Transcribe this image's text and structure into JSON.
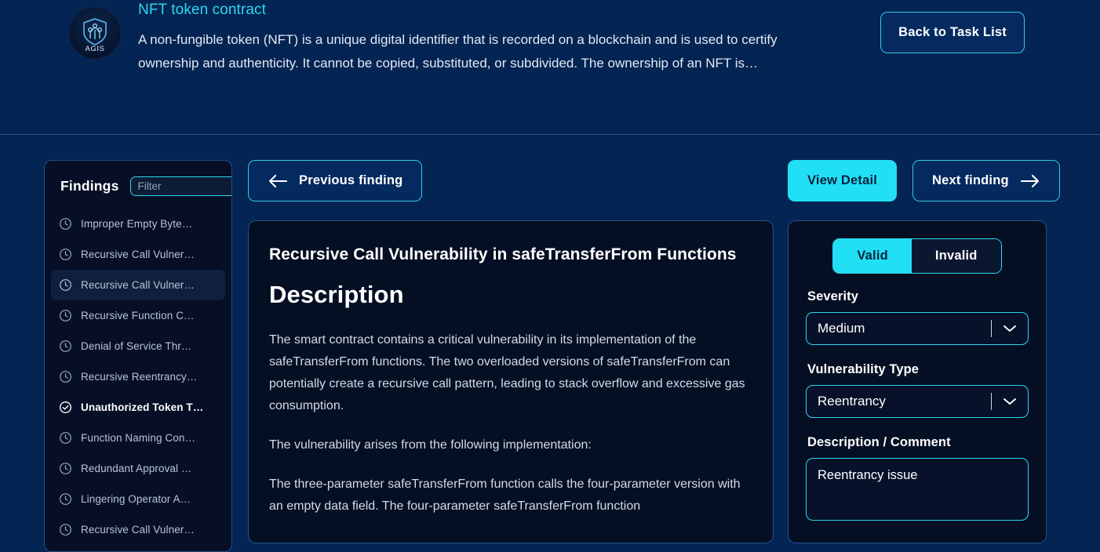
{
  "header": {
    "logo_text": "AGIS",
    "task_title": "NFT token contract",
    "task_description": "A non-fungible token (NFT) is a unique digital identifier that is recorded on a blockchain and is used to certify ownership and authenticity. It cannot be copied, substituted, or subdivided. The ownership of an NFT is…",
    "back_button": "Back to Task List"
  },
  "sidebar": {
    "title": "Findings",
    "filter_placeholder": "Filter",
    "filter_value": "",
    "items": [
      {
        "label": "Improper Empty Byte…",
        "status": "pending"
      },
      {
        "label": "Recursive Call Vulner…",
        "status": "pending"
      },
      {
        "label": "Recursive Call Vulner…",
        "status": "selected"
      },
      {
        "label": "Recursive Function C…",
        "status": "pending"
      },
      {
        "label": "Denial of Service Thr…",
        "status": "pending"
      },
      {
        "label": "Recursive Reentrancy…",
        "status": "pending"
      },
      {
        "label": "Unauthorized Token T…",
        "status": "reviewed"
      },
      {
        "label": "Function Naming Con…",
        "status": "pending"
      },
      {
        "label": "Redundant Approval …",
        "status": "pending"
      },
      {
        "label": "Lingering Operator A…",
        "status": "pending"
      },
      {
        "label": "Recursive Call Vulner…",
        "status": "pending"
      }
    ]
  },
  "nav": {
    "previous_label": "Previous finding",
    "view_detail_label": "View Detail",
    "next_label": "Next finding"
  },
  "detail": {
    "title": "Recursive Call Vulnerability in safeTransferFrom Functions",
    "section_heading": "Description",
    "paragraphs": [
      "The smart contract contains a critical vulnerability in its implementation of the safeTransferFrom functions. The two overloaded versions of safeTransferFrom can potentially create a recursive call pattern, leading to stack overflow and excessive gas consumption.",
      "The vulnerability arises from the following implementation:",
      "The three-parameter safeTransferFrom function calls the four-parameter version with an empty data field. The four-parameter safeTransferFrom function"
    ]
  },
  "review": {
    "valid_label": "Valid",
    "invalid_label": "Invalid",
    "selected_validity": "Valid",
    "severity_label": "Severity",
    "severity_value": "Medium",
    "vuln_type_label": "Vulnerability Type",
    "vuln_type_value": "Reentrancy",
    "comment_label": "Description / Comment",
    "comment_value": "Reentrancy issue"
  },
  "colors": {
    "accent_cyan": "#21e0f5",
    "title_cyan": "#2fd6ef",
    "header_bg": "#042453",
    "panel_bg": "#050f23",
    "panel_border": "#23508f"
  }
}
